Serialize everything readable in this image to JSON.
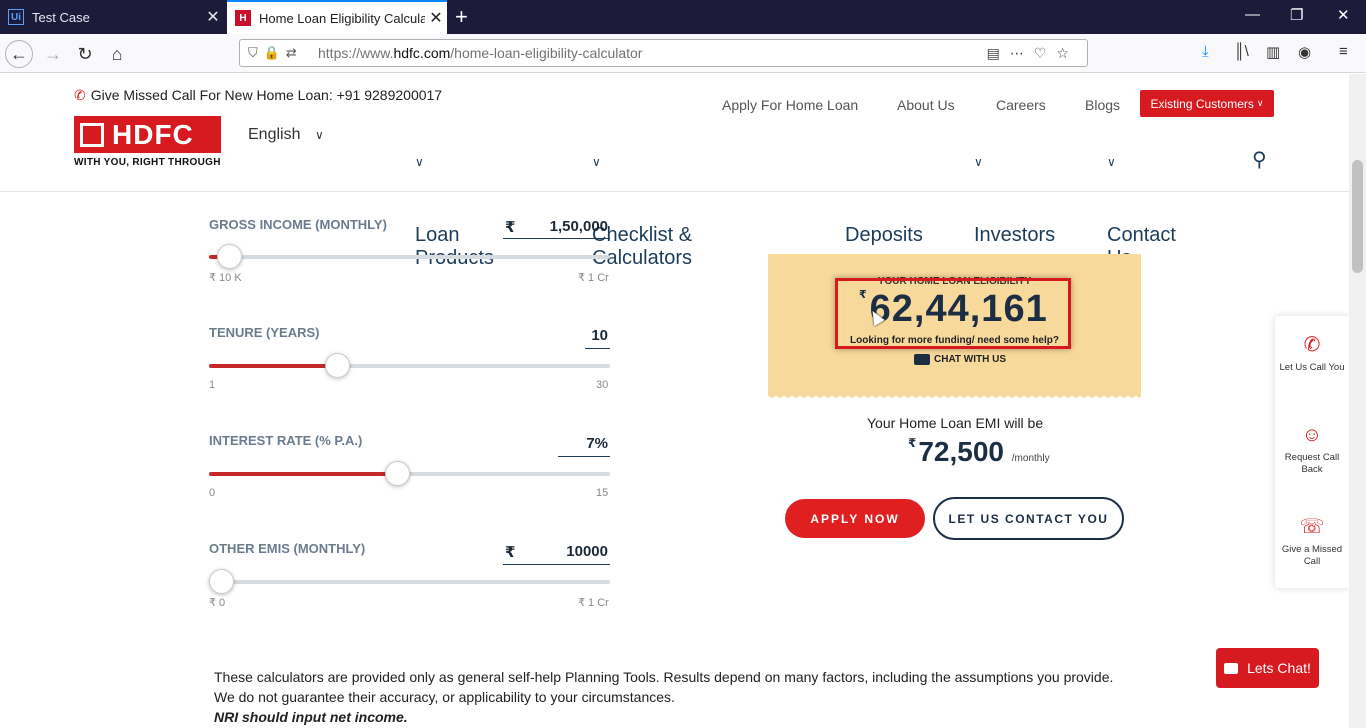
{
  "browser": {
    "tabs": [
      {
        "label": "Test Case",
        "icon": "Ui"
      },
      {
        "label": "Home Loan Eligibility Calculato",
        "icon": "H"
      }
    ],
    "url_prefix": "https://www.",
    "url_domain": "hdfc.com",
    "url_path": "/home-loan-eligibility-calculator"
  },
  "header": {
    "missed_call": "Give Missed Call For New Home Loan: +91 9289200017",
    "logo_text": "HDFC",
    "logo_tagline": "WITH YOU, RIGHT THROUGH",
    "language": "English",
    "top_links": [
      "Apply For Home Loan",
      "About Us",
      "Careers",
      "Blogs"
    ],
    "existing_customers": "Existing Customers",
    "main_nav": [
      "Loan Products",
      "Checklist & Calculators",
      "Deposits",
      "Investors",
      "Contact Us"
    ]
  },
  "calculator": {
    "gross_income": {
      "label": "GROSS INCOME (MONTHLY)",
      "currency": "₹",
      "value": "1,50,000",
      "min": "₹ 10 K",
      "max": "₹ 1 Cr",
      "level": 0.05
    },
    "tenure": {
      "label": "TENURE (YEARS)",
      "value": "10",
      "min": "1",
      "max": "30",
      "level": 0.32
    },
    "interest": {
      "label": "INTEREST RATE (% P.A.)",
      "value": "7%",
      "min": "0",
      "max": "15",
      "level": 0.47
    },
    "other_emis": {
      "label": "OTHER EMIS (MONTHLY)",
      "currency": "₹",
      "value": "10000",
      "min": "₹ 0",
      "max": "₹ 1 Cr",
      "level": 0.0
    }
  },
  "result": {
    "eligibility_label": "YOUR HOME LOAN ELIGIBILITY",
    "currency": "₹",
    "eligibility_amount": "62,44,161",
    "funding_text": "Looking for more funding/ need some help?",
    "chat_with_us": "CHAT WITH US",
    "emi_label": "Your Home Loan EMI will be",
    "emi_amount": "72,500",
    "emi_period": "/monthly",
    "apply_now": "APPLY NOW",
    "contact_us": "LET US CONTACT YOU"
  },
  "side_widget": {
    "items": [
      "Let Us Call You",
      "Request Call Back",
      "Give a Missed Call"
    ]
  },
  "disclaimer": {
    "line1": "These calculators are provided only as general self-help Planning Tools. Results depend on many factors, including the assumptions you provide.",
    "line2": "We do not guarantee their accuracy, or applicability to your circumstances.",
    "line3": "NRI should input net income."
  },
  "lets_chat": "Lets Chat!",
  "colors": {
    "brand_red": "#d71920",
    "navy": "#1c2e44",
    "card_bg": "#f8d99c"
  }
}
